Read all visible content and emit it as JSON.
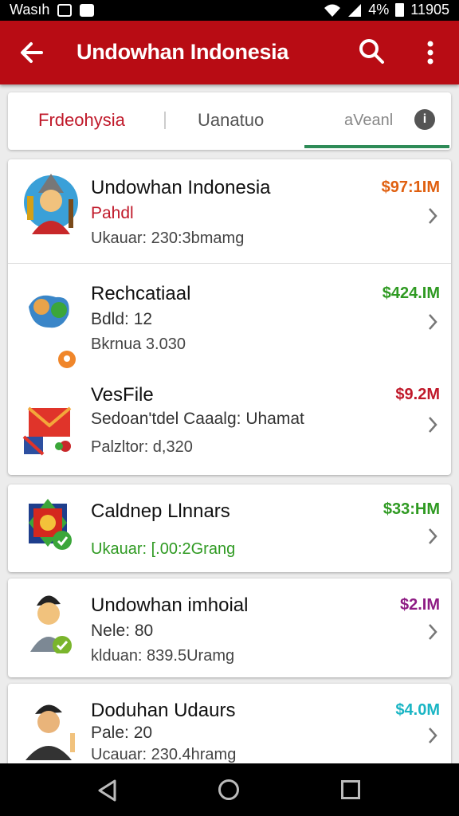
{
  "status_bar": {
    "carrier": "Wasıh",
    "battery_pct": "4%",
    "time": "11905"
  },
  "app_bar": {
    "title": "Undowhan Indonesia",
    "icons": [
      "back-arrow-icon",
      "search-icon",
      "more-vert-icon"
    ]
  },
  "tabs": [
    {
      "label": "Frdeohysia",
      "active": false
    },
    {
      "label": "Uanatuo",
      "active": false
    },
    {
      "label": "aVeanl",
      "active": true
    }
  ],
  "items": [
    {
      "name": "Undowhan Indonesia",
      "subtitle": "Pahdl",
      "meta": "Ukauar: 230:3bmamg",
      "price": "$97:1IM",
      "price_color": "#e06010"
    },
    {
      "name": "Rechcatiaal",
      "subtitle": "Bdld: 12",
      "meta": "Bkrnua 3.030",
      "price": "$424.IM",
      "price_color": "#2f9a22"
    },
    {
      "name": "VesFile",
      "subtitle": "Sedoan'tdel Caaalg: Uhamat",
      "meta": "Palzltor: d,320",
      "price": "$9.2M",
      "price_color": "#c0192a"
    },
    {
      "name": "Caldnep Llnnars",
      "subtitle": "",
      "meta": "Ukauar: [.00:2Grang",
      "price": "$33:HM",
      "price_color": "#2f9a22"
    },
    {
      "name": "Undowhan imhoial",
      "subtitle": "Nele: 80",
      "meta": "klduan: 839.5Uramg",
      "price": "$2.IM",
      "price_color": "#8e1c84"
    },
    {
      "name": "Doduhan Udaurs",
      "subtitle": "Pale: 20",
      "meta": "Ucauar: 230.4hramg",
      "price": "$4.0M",
      "price_color": "#1ab5c4"
    }
  ],
  "nav_bar": {
    "icons": [
      "nav-back-icon",
      "nav-home-icon",
      "nav-recents-icon"
    ]
  }
}
